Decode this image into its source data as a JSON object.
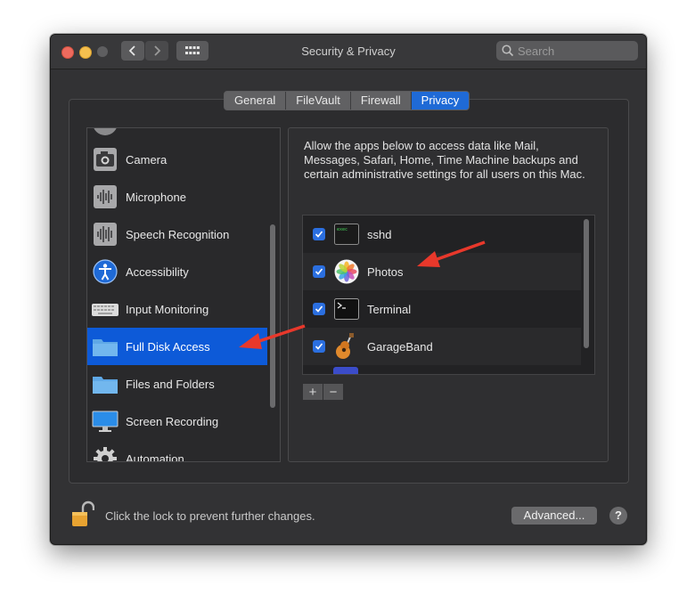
{
  "window": {
    "title": "Security & Privacy",
    "search_placeholder": "Search"
  },
  "tabs": [
    {
      "label": "General",
      "active": false
    },
    {
      "label": "FileVault",
      "active": false
    },
    {
      "label": "Firewall",
      "active": false
    },
    {
      "label": "Privacy",
      "active": true
    }
  ],
  "sidebar": {
    "items": [
      {
        "label": "Camera",
        "icon": "camera-icon",
        "selected": false
      },
      {
        "label": "Microphone",
        "icon": "microphone-icon",
        "selected": false
      },
      {
        "label": "Speech Recognition",
        "icon": "speech-recognition-icon",
        "selected": false
      },
      {
        "label": "Accessibility",
        "icon": "accessibility-icon",
        "selected": false
      },
      {
        "label": "Input Monitoring",
        "icon": "keyboard-icon",
        "selected": false
      },
      {
        "label": "Full Disk Access",
        "icon": "folder-icon",
        "selected": true
      },
      {
        "label": "Files and Folders",
        "icon": "folder-icon",
        "selected": false
      },
      {
        "label": "Screen Recording",
        "icon": "display-icon",
        "selected": false
      },
      {
        "label": "Automation",
        "icon": "gear-icon",
        "selected": false
      }
    ]
  },
  "panel": {
    "description": "Allow the apps below to access data like Mail, Messages, Safari, Home, Time Machine backups and certain administrative settings for all users on this Mac.",
    "apps": [
      {
        "label": "sshd",
        "icon": "terminal-exec-icon",
        "checked": true
      },
      {
        "label": "Photos",
        "icon": "photos-icon",
        "checked": true
      },
      {
        "label": "Terminal",
        "icon": "terminal-icon",
        "checked": true
      },
      {
        "label": "GarageBand",
        "icon": "garageband-icon",
        "checked": true
      }
    ],
    "add_label": "+",
    "remove_label": "−"
  },
  "footer": {
    "lock_text": "Click the lock to prevent further changes.",
    "advanced_label": "Advanced...",
    "help_label": "?"
  },
  "colors": {
    "accent": "#0d5ad8",
    "arrow": "#e8382b"
  }
}
